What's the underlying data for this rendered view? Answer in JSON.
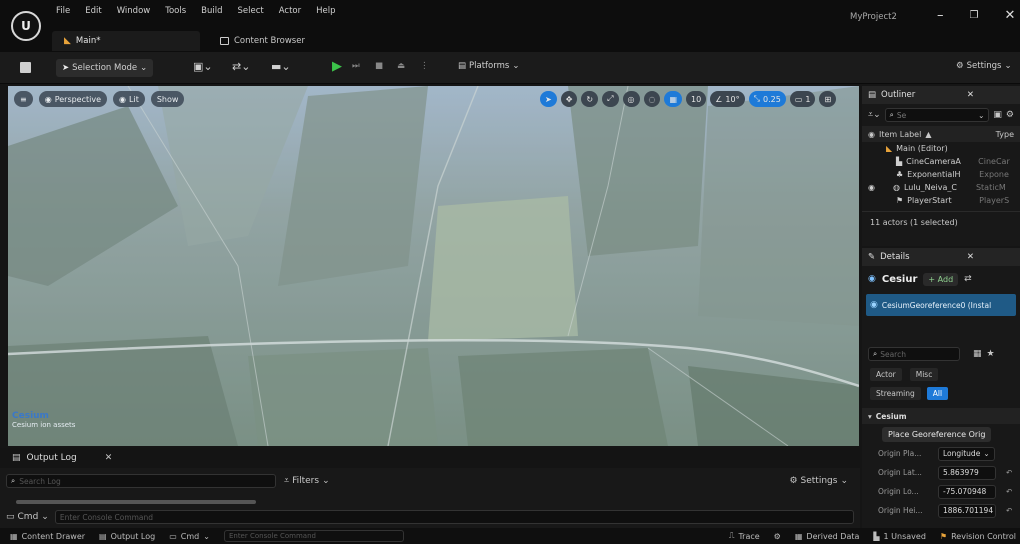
{
  "menu": [
    "File",
    "Edit",
    "Window",
    "Tools",
    "Build",
    "Select",
    "Actor",
    "Help"
  ],
  "tabs": {
    "main": "Main*",
    "content_browser": "Content Browser"
  },
  "project_name": "MyProject2",
  "toolbar": {
    "selection_mode": "Selection Mode",
    "platforms": "Platforms",
    "settings": "Settings"
  },
  "viewport": {
    "perspective": "Perspective",
    "lit": "Lit",
    "show": "Show",
    "grid_size": "10",
    "rotation_snap": "10°",
    "scale_snap": "0.25",
    "camera_speed": "1",
    "watermark_brand": "Cesium",
    "watermark_sub": "Cesium ion assets"
  },
  "outliner": {
    "title": "Outliner",
    "search_placeholder": "Se",
    "col_label": "Item Label",
    "col_type": "Type",
    "items": [
      {
        "label": "Main (Editor)",
        "type": ""
      },
      {
        "label": "CineCameraA",
        "type": "CineCar"
      },
      {
        "label": "ExponentialH",
        "type": "Expone"
      },
      {
        "label": "Lulu_Neiva_C",
        "type": "StaticM"
      },
      {
        "label": "PlayerStart",
        "type": "PlayerS"
      }
    ],
    "status": "11 actors (1 selected)"
  },
  "details": {
    "title": "Details",
    "actor_name": "Cesiur",
    "add_label": "+ Add",
    "component": "CesiumGeoreference0 (Instal",
    "search_placeholder": "Search",
    "filters": [
      "Actor",
      "Misc",
      "Streaming",
      "All"
    ],
    "section": "Cesium",
    "place_button": "Place Georeference Orig",
    "props": [
      {
        "label": "Origin Pla...",
        "value": "Longitude"
      },
      {
        "label": "Origin Lat...",
        "value": "5.863979"
      },
      {
        "label": "Origin Lo...",
        "value": "-75.070948"
      },
      {
        "label": "Origin Hei...",
        "value": "1886.701194"
      }
    ]
  },
  "outputlog": {
    "title": "Output Log",
    "search_placeholder": "Search Log",
    "filters": "Filters",
    "settings": "Settings",
    "cmd": "Cmd",
    "cmd_placeholder": "Enter Console Command"
  },
  "statusbar": {
    "content_drawer": "Content Drawer",
    "output_log": "Output Log",
    "cmd": "Cmd",
    "cmd_placeholder": "Enter Console Command",
    "trace": "Trace",
    "derived_data": "Derived Data",
    "unsaved": "1 Unsaved",
    "revision": "Revision Control"
  }
}
